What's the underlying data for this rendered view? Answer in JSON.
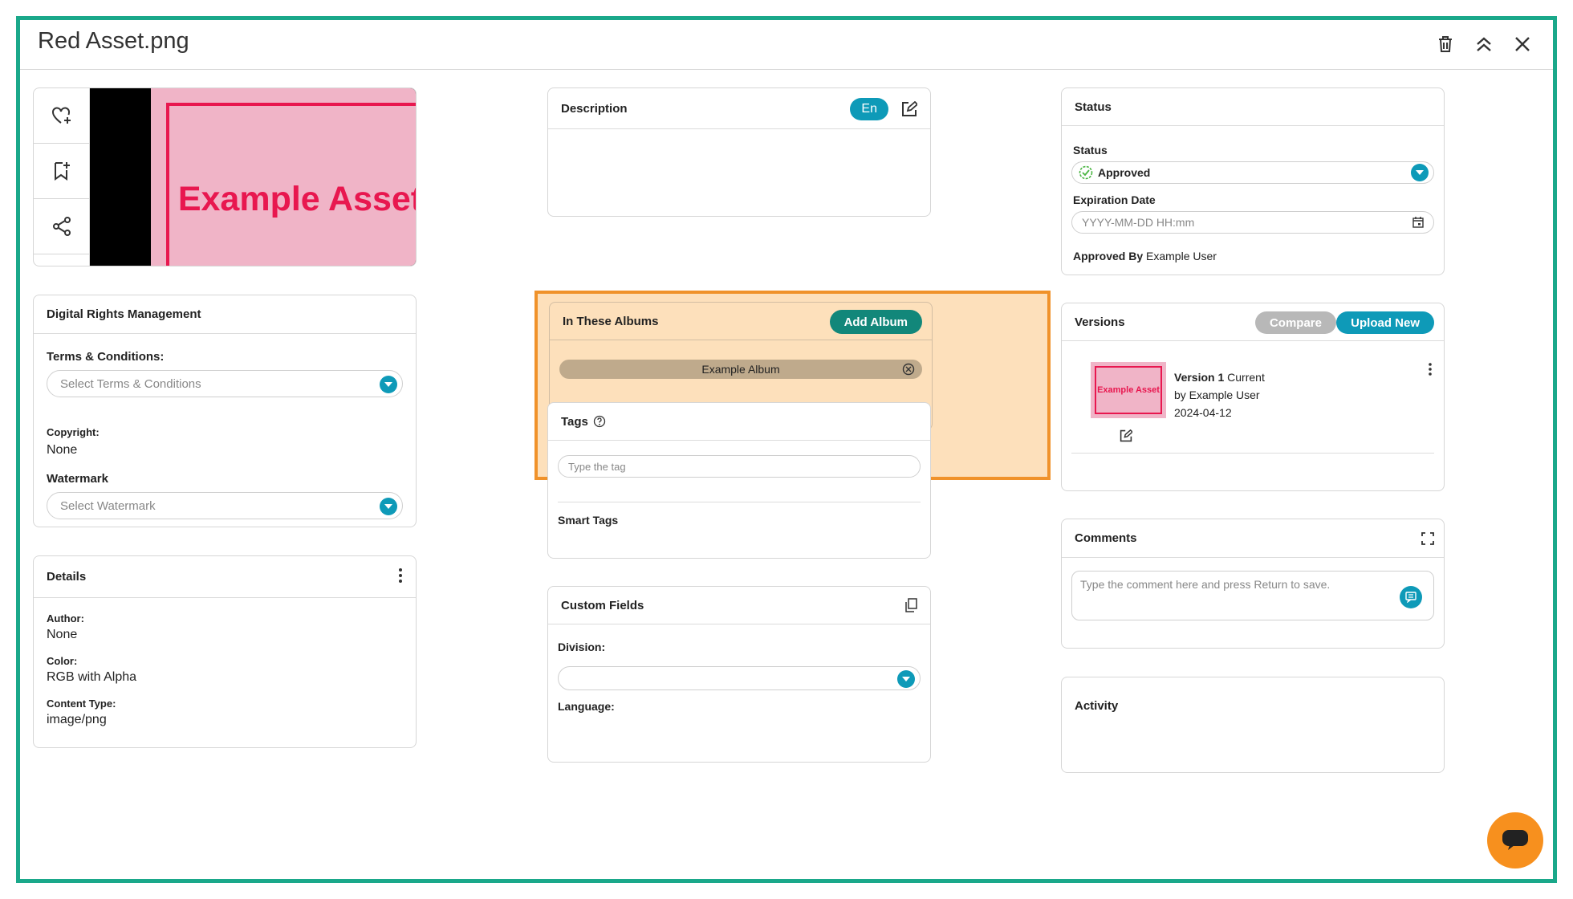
{
  "header": {
    "title": "Red Asset.png"
  },
  "preview": {
    "text": "Example Asset"
  },
  "drm": {
    "title": "Digital Rights Management",
    "terms_label": "Terms & Conditions:",
    "terms_placeholder": "Select Terms & Conditions",
    "copyright_label": "Copyright:",
    "copyright_value": "None",
    "watermark_label": "Watermark",
    "watermark_placeholder": "Select Watermark"
  },
  "details": {
    "title": "Details",
    "author_label": "Author:",
    "author_value": "None",
    "color_label": "Color:",
    "color_value": "RGB with Alpha",
    "content_type_label": "Content Type:",
    "content_type_value": "image/png"
  },
  "description": {
    "title": "Description",
    "lang": "En"
  },
  "albums": {
    "title": "In These Albums",
    "add_label": "Add Album",
    "items": [
      "Example Album"
    ]
  },
  "tags": {
    "title": "Tags",
    "placeholder": "Type the tag",
    "smart_title": "Smart Tags"
  },
  "custom_fields": {
    "title": "Custom Fields",
    "division_label": "Division:",
    "language_label": "Language:"
  },
  "status": {
    "title": "Status",
    "status_label": "Status",
    "status_value": "Approved",
    "expiration_label": "Expiration Date",
    "expiration_placeholder": "YYYY-MM-DD HH:mm",
    "approved_by_label": "Approved By",
    "approved_by_value": "Example User"
  },
  "versions": {
    "title": "Versions",
    "compare_label": "Compare",
    "upload_label": "Upload New",
    "item": {
      "thumb_text": "Example Asset",
      "version_label": "Version 1",
      "current_label": "Current",
      "by": "by Example User",
      "date": "2024-04-12"
    }
  },
  "comments": {
    "title": "Comments",
    "placeholder": "Type the comment here and press Return to save."
  },
  "activity": {
    "title": "Activity"
  },
  "colors": {
    "accent": "#0e9ab8",
    "teal": "#12877a",
    "frame": "#1aa88a",
    "highlight": "#fde0bb",
    "asset_pink": "#f0b4c7",
    "asset_red": "#e8174f",
    "fab": "#f7901e"
  }
}
